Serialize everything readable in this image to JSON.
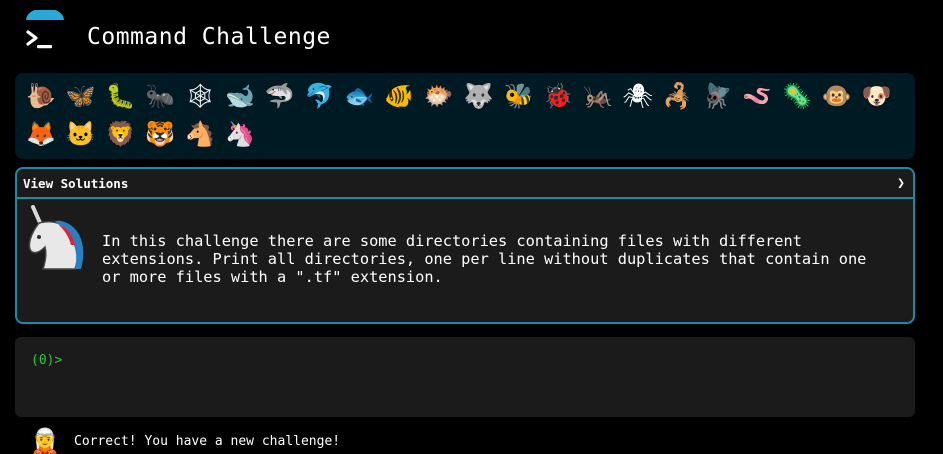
{
  "header": {
    "title": "Command Challenge",
    "logo_icon": "terminal-prompt-icon",
    "logo_color": "#2aa9d8"
  },
  "animals": [
    {
      "name": "snail",
      "glyph": "🐌"
    },
    {
      "name": "butterfly",
      "glyph": "🦋"
    },
    {
      "name": "caterpillar",
      "glyph": "🐛"
    },
    {
      "name": "ant",
      "glyph": "🐜"
    },
    {
      "name": "spider-web",
      "glyph": "🕸"
    },
    {
      "name": "whale",
      "glyph": "🐋"
    },
    {
      "name": "shark",
      "glyph": "🦈"
    },
    {
      "name": "dolphin",
      "glyph": "🐬"
    },
    {
      "name": "fish",
      "glyph": "🐟"
    },
    {
      "name": "tropical-fish",
      "glyph": "🐠"
    },
    {
      "name": "blowfish",
      "glyph": "🐡"
    },
    {
      "name": "wolf",
      "glyph": "🐺"
    },
    {
      "name": "bee",
      "glyph": "🐝"
    },
    {
      "name": "ladybug",
      "glyph": "🐞"
    },
    {
      "name": "cricket",
      "glyph": "🦗"
    },
    {
      "name": "spider",
      "glyph": "🕷"
    },
    {
      "name": "scorpion",
      "glyph": "🦂"
    },
    {
      "name": "fly",
      "glyph": "🪰"
    },
    {
      "name": "worm",
      "glyph": "🪱"
    },
    {
      "name": "microbe",
      "glyph": "🦠"
    },
    {
      "name": "monkey",
      "glyph": "🐵"
    },
    {
      "name": "dog",
      "glyph": "🐶"
    },
    {
      "name": "fox",
      "glyph": "🦊"
    },
    {
      "name": "cat",
      "glyph": "🐱"
    },
    {
      "name": "lion",
      "glyph": "🦁"
    },
    {
      "name": "tiger",
      "glyph": "🐯"
    },
    {
      "name": "horse",
      "glyph": "🐴"
    },
    {
      "name": "unicorn",
      "glyph": "🦄"
    }
  ],
  "solutions": {
    "label": "View Solutions",
    "chevron": "❯"
  },
  "challenge": {
    "icon": "unicorn-icon",
    "text": "In this challenge there are some directories containing files with different\nextensions. Print all directories, one per line without duplicates that contain one\nor more files with a \".tf\" extension."
  },
  "terminal": {
    "prompt": "(0)>",
    "value": "",
    "prompt_color": "#27c93f"
  },
  "status": {
    "icon": "elf-icon",
    "glyph": "🧝",
    "text": "Correct! You have a new challenge!"
  },
  "colors": {
    "accent": "#1e88a8",
    "animal_bar_bg": "#001a24",
    "panel_bg": "#1b1b1b"
  }
}
